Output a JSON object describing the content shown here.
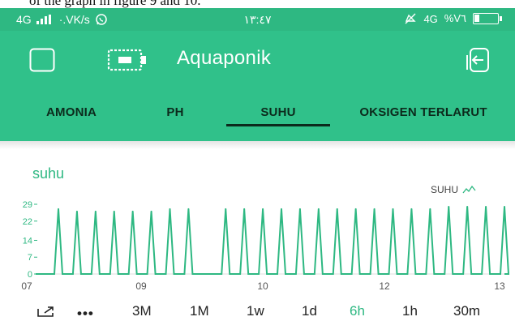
{
  "caption_fragment": "of the graph in figure 9 and 10.",
  "status_bar": {
    "network_left": "4G",
    "speed": "·.VK/s",
    "time": "١٣:٤٧",
    "network_right": "4G",
    "battery_percent": "%V٦"
  },
  "app_bar": {
    "title": "Aquaponik"
  },
  "tabs": [
    {
      "label": "AMONIA",
      "active": false
    },
    {
      "label": "PH",
      "active": false
    },
    {
      "label": "SUHU",
      "active": true
    },
    {
      "label": "OKSIGEN TERLARUT",
      "active": false
    }
  ],
  "chart_title": "suhu",
  "chart_data": {
    "type": "line",
    "title": "suhu",
    "legend": [
      "SUHU"
    ],
    "y_ticks": [
      "29",
      "22",
      "14",
      "7",
      "0"
    ],
    "ylim": [
      0,
      29
    ],
    "x_ticks": [
      "07",
      "09",
      "10",
      "12",
      "13"
    ],
    "series": [
      {
        "name": "SUHU",
        "color": "#2eb882",
        "spike_values": [
          27,
          26,
          26,
          26,
          26,
          26,
          27,
          27,
          0,
          27,
          27,
          27,
          27,
          27,
          27,
          27,
          27,
          27,
          27,
          27,
          27,
          28,
          28,
          28,
          28
        ]
      }
    ]
  },
  "time_ranges": [
    "3M",
    "1M",
    "1w",
    "1d",
    "6h",
    "1h",
    "30m"
  ],
  "active_range": "6h",
  "colors": {
    "accent": "#30c18a",
    "status": "#2eb882",
    "tab_text": "#0c2a1c"
  }
}
